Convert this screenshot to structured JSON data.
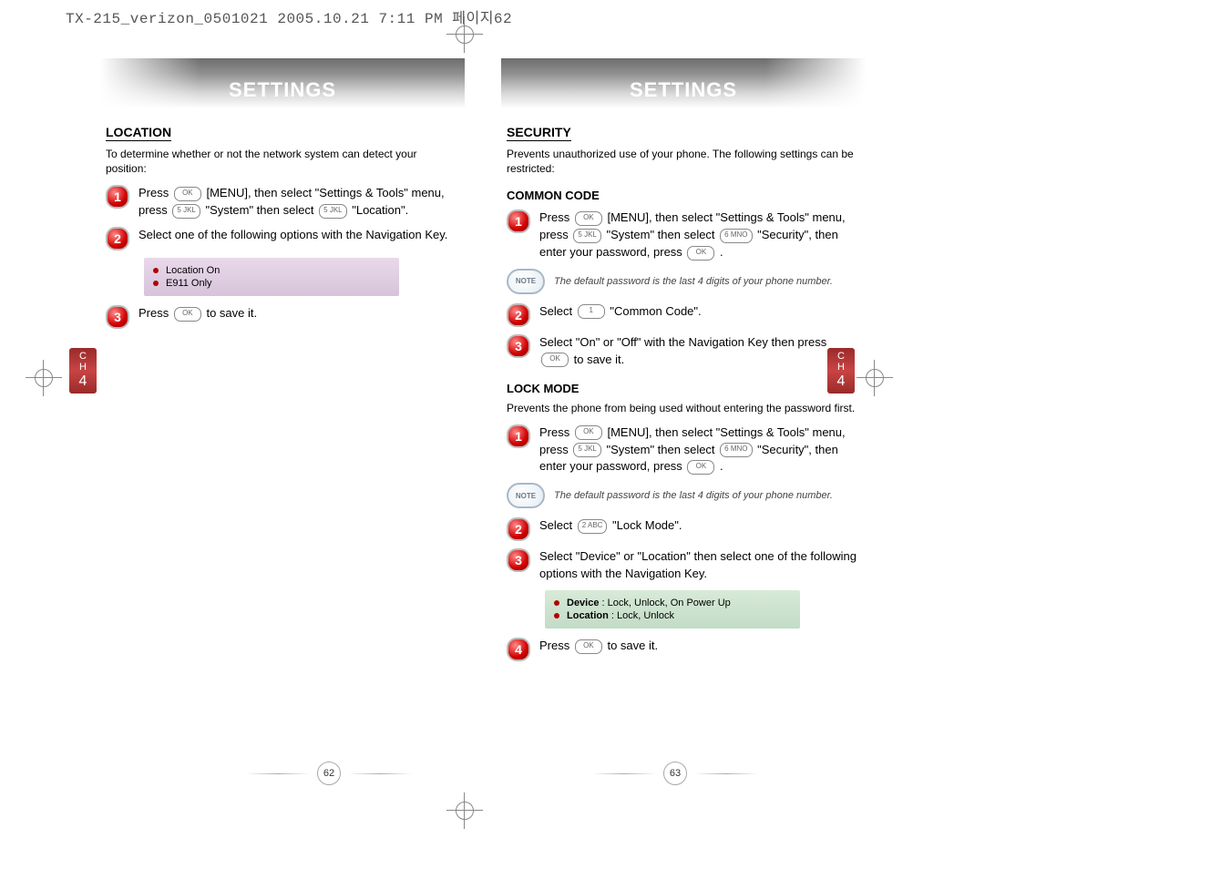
{
  "file_header": "TX-215_verizon_0501021 2005.10.21 7:11 PM 페이지62",
  "side_tab": {
    "label_top": "C",
    "label_mid": "H",
    "number": "4"
  },
  "left": {
    "banner": "SETTINGS",
    "section": "LOCATION",
    "intro": "To determine whether or not the network system can detect your position:",
    "steps": [
      {
        "n": "1",
        "pre": "Press ",
        "k1": "OK",
        "mid1": " [MENU], then select \"Settings & Tools\" menu, press ",
        "k2": "5 JKL",
        "mid2": " \"System\" then select ",
        "k3": "5 JKL",
        "post": " \"Location\"."
      },
      {
        "n": "2",
        "text": "Select one of the following options with the Navigation Key."
      },
      {
        "n": "3",
        "pre": "Press ",
        "k1": "OK",
        "post": " to save it."
      }
    ],
    "options": [
      "Location On",
      "E911 Only"
    ],
    "page": "62"
  },
  "right": {
    "banner": "SETTINGS",
    "section": "SECURITY",
    "intro": "Prevents unauthorized use of your phone. The following settings can be restricted:",
    "common": {
      "title": "COMMON CODE",
      "steps": [
        {
          "n": "1",
          "pre": "Press ",
          "k1": "OK",
          "mid1": " [MENU], then select \"Settings & Tools\" menu, press ",
          "k2": "5 JKL",
          "mid2": " \"System\" then select ",
          "k3": "6 MNO",
          "mid3": " \"Security\", then enter your password, press ",
          "k4": "OK",
          "post": " ."
        },
        {
          "n": "2",
          "pre": "Select ",
          "k1": "1",
          "post": " \"Common Code\"."
        },
        {
          "n": "3",
          "pre": "Select \"On\" or \"Off\" with the Navigation Key then press ",
          "k1": "OK",
          "post": " to save it."
        }
      ],
      "note": "The default password is the last 4 digits of your phone number."
    },
    "lock": {
      "title": "LOCK MODE",
      "intro": "Prevents the phone from being used without entering the password first.",
      "steps": [
        {
          "n": "1",
          "pre": "Press ",
          "k1": "OK",
          "mid1": " [MENU], then select \"Settings & Tools\" menu, press ",
          "k2": "5 JKL",
          "mid2": " \"System\" then select ",
          "k3": "6 MNO",
          "mid3": " \"Security\", then enter your password, press ",
          "k4": "OK",
          "post": " ."
        },
        {
          "n": "2",
          "pre": "Select ",
          "k1": "2 ABC",
          "post": " \"Lock Mode\"."
        },
        {
          "n": "3",
          "text": "Select \"Device\" or \"Location\" then select one of the following options with the Navigation Key."
        },
        {
          "n": "4",
          "pre": "Press ",
          "k1": "OK",
          "post": " to save it."
        }
      ],
      "note": "The default password is the last 4 digits of your phone number.",
      "options": [
        {
          "bold": "Device",
          "rest": " : Lock, Unlock, On Power Up"
        },
        {
          "bold": "Location",
          "rest": " : Lock, Unlock"
        }
      ]
    },
    "page": "63"
  },
  "note_badge": "NOTE"
}
